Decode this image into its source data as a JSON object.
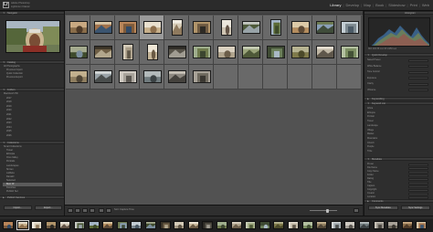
{
  "app": {
    "logo_text": "Lr",
    "info_line1": "Adobe Photoshop",
    "info_line2": "Lightroom Classic"
  },
  "modules": [
    {
      "label": "Library",
      "active": true
    },
    {
      "label": "Develop",
      "active": false
    },
    {
      "label": "Map",
      "active": false
    },
    {
      "label": "Book",
      "active": false
    },
    {
      "label": "Slideshow",
      "active": false
    },
    {
      "label": "Print",
      "active": false
    },
    {
      "label": "Web",
      "active": false
    }
  ],
  "left_panel": {
    "navigator_label": "Navigator",
    "catalog_label": "Catalog",
    "catalog_items": [
      "All Photographs",
      "Previous Import",
      "Quick Collection",
      "Previous Export"
    ],
    "folders_label": "Folders",
    "folder_rows": [
      "Macintosh HD",
      "2017",
      "2018",
      "2019",
      "2020",
      "2021",
      "2022",
      "2023",
      "2024",
      "2025",
      "2026"
    ],
    "collections_label": "Collections",
    "collection_rows": [
      "Smart Collections",
      "Travel",
      "Ethiopia",
      "Omo Valley",
      "Portraits",
      "Landscapes",
      "Simien",
      "Lalibela",
      "Danakil",
      "Selected",
      "Best Of",
      "Favorites",
      "Publish Set"
    ],
    "publish_label": "Publish Services",
    "import_button": "Import...",
    "export_button": "Export..."
  },
  "grid": {
    "cells_per_row": 12,
    "rows": 3,
    "photo_count": 30,
    "selected_index": 3
  },
  "toolbar": {
    "sort_label": "Sort: Capture Time"
  },
  "right_panel": {
    "histogram_label": "Histogram",
    "histogram_info": "ISO 200   35 mm   f/8   1/250 sec",
    "quick_develop_label": "Quick Develop",
    "quick_rows": [
      "Saved Preset",
      "White Balance",
      "Tone Control",
      "Exposure",
      "Clarity",
      "Vibrance"
    ],
    "keywording_label": "Keywording",
    "keyword_list_label": "Keyword List",
    "keyword_rows": [
      "Africa",
      "Ethiopia",
      "Portrait",
      "Travel",
      "Landscape",
      "Village",
      "Market",
      "Mountains",
      "Church",
      "People",
      "Tribe"
    ],
    "metadata_label": "Metadata",
    "metadata_rows": [
      "Preset",
      "File Name",
      "Copy Name",
      "Folder",
      "Rating",
      "Title",
      "Caption",
      "Copyright",
      "Creator",
      "Location"
    ],
    "comments_label": "Comments",
    "sync_button": "Sync Metadata",
    "sync_settings_button": "Sync Settings"
  },
  "filmstrip": {
    "count": 30
  }
}
